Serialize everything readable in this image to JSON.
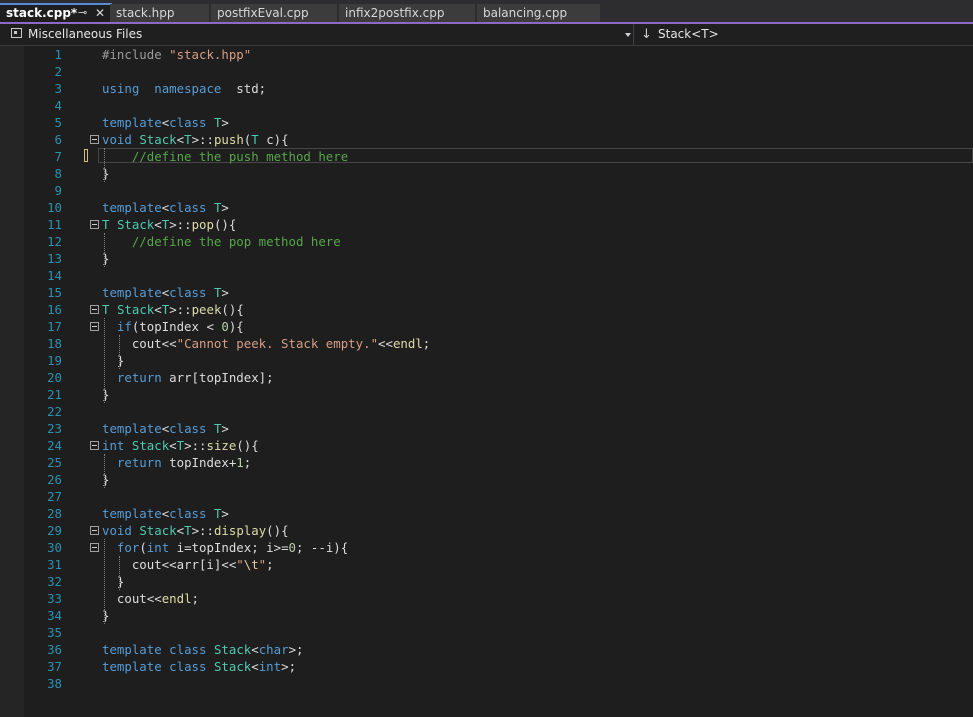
{
  "tabs": [
    {
      "label": "stack.cpp*",
      "active": true
    },
    {
      "label": "stack.hpp",
      "active": false
    },
    {
      "label": "postfixEval.cpp",
      "active": false
    },
    {
      "label": "infix2postfix.cpp",
      "active": false
    },
    {
      "label": "balancing.cpp",
      "active": false
    }
  ],
  "tab_icons": {
    "pin": "⊸",
    "close": "✕"
  },
  "navbar": {
    "project": "Miscellaneous Files",
    "scope": "Stack<T>"
  },
  "colors": {
    "keyword": "#569cd6",
    "type": "#4ec9b0",
    "function": "#dcdcaa",
    "string": "#d69d85",
    "comment": "#57a64a",
    "number": "#b5cea8",
    "line_number": "#2b91af",
    "accent": "#8f68c9"
  },
  "editor": {
    "current_line": 7,
    "lines": [
      {
        "n": "1",
        "code": [
          [
            "pp",
            "#include "
          ],
          [
            "str",
            "\"stack.hpp\""
          ]
        ]
      },
      {
        "n": "2",
        "code": []
      },
      {
        "n": "3",
        "code": [
          [
            "kw",
            "using"
          ],
          [
            "",
            "  "
          ],
          [
            "kw",
            "namespace"
          ],
          [
            "",
            "  std;"
          ]
        ]
      },
      {
        "n": "4",
        "code": []
      },
      {
        "n": "5",
        "code": [
          [
            "kw",
            "template"
          ],
          [
            "",
            "<"
          ],
          [
            "kw",
            "class"
          ],
          [
            "",
            " "
          ],
          [
            "ty",
            "T"
          ],
          [
            "",
            ">"
          ]
        ]
      },
      {
        "n": "6",
        "code": [
          [
            "kw",
            "void"
          ],
          [
            "",
            " "
          ],
          [
            "ty",
            "Stack"
          ],
          [
            "",
            "<"
          ],
          [
            "ty",
            "T"
          ],
          [
            "",
            ">::"
          ],
          [
            "fn",
            "push"
          ],
          [
            "",
            "("
          ],
          [
            "ty",
            "T"
          ],
          [
            "",
            " c){"
          ]
        ]
      },
      {
        "n": "7",
        "code": [
          [
            "",
            "    "
          ],
          [
            "cm",
            "//define the push method here"
          ]
        ]
      },
      {
        "n": "8",
        "code": [
          [
            "",
            "}"
          ]
        ]
      },
      {
        "n": "9",
        "code": []
      },
      {
        "n": "10",
        "code": [
          [
            "kw",
            "template"
          ],
          [
            "",
            "<"
          ],
          [
            "kw",
            "class"
          ],
          [
            "",
            " "
          ],
          [
            "ty",
            "T"
          ],
          [
            "",
            ">"
          ]
        ]
      },
      {
        "n": "11",
        "code": [
          [
            "ty",
            "T"
          ],
          [
            "",
            " "
          ],
          [
            "ty",
            "Stack"
          ],
          [
            "",
            "<"
          ],
          [
            "ty",
            "T"
          ],
          [
            "",
            ">::"
          ],
          [
            "fn",
            "pop"
          ],
          [
            "",
            "(){"
          ]
        ]
      },
      {
        "n": "12",
        "code": [
          [
            "",
            "    "
          ],
          [
            "cm",
            "//define the pop method here"
          ]
        ]
      },
      {
        "n": "13",
        "code": [
          [
            "",
            "}"
          ]
        ]
      },
      {
        "n": "14",
        "code": []
      },
      {
        "n": "15",
        "code": [
          [
            "kw",
            "template"
          ],
          [
            "",
            "<"
          ],
          [
            "kw",
            "class"
          ],
          [
            "",
            " "
          ],
          [
            "ty",
            "T"
          ],
          [
            "",
            ">"
          ]
        ]
      },
      {
        "n": "16",
        "code": [
          [
            "ty",
            "T"
          ],
          [
            "",
            " "
          ],
          [
            "ty",
            "Stack"
          ],
          [
            "",
            "<"
          ],
          [
            "ty",
            "T"
          ],
          [
            "",
            ">::"
          ],
          [
            "fn",
            "peek"
          ],
          [
            "",
            "(){"
          ]
        ]
      },
      {
        "n": "17",
        "code": [
          [
            "",
            "  "
          ],
          [
            "kw",
            "if"
          ],
          [
            "",
            "(topIndex < "
          ],
          [
            "num",
            "0"
          ],
          [
            "",
            "){"
          ]
        ]
      },
      {
        "n": "18",
        "code": [
          [
            "",
            "    cout<<"
          ],
          [
            "str",
            "\"Cannot peek. Stack empty.\""
          ],
          [
            "",
            "<<"
          ],
          [
            "fn",
            "endl"
          ],
          [
            "",
            ";"
          ]
        ]
      },
      {
        "n": "19",
        "code": [
          [
            "",
            "  }"
          ]
        ]
      },
      {
        "n": "20",
        "code": [
          [
            "",
            "  "
          ],
          [
            "kw",
            "return"
          ],
          [
            "",
            " arr[topIndex];"
          ]
        ]
      },
      {
        "n": "21",
        "code": [
          [
            "",
            "}"
          ]
        ]
      },
      {
        "n": "22",
        "code": []
      },
      {
        "n": "23",
        "code": [
          [
            "kw",
            "template"
          ],
          [
            "",
            "<"
          ],
          [
            "kw",
            "class"
          ],
          [
            "",
            " "
          ],
          [
            "ty",
            "T"
          ],
          [
            "",
            ">"
          ]
        ]
      },
      {
        "n": "24",
        "code": [
          [
            "kw",
            "int"
          ],
          [
            "",
            " "
          ],
          [
            "ty",
            "Stack"
          ],
          [
            "",
            "<"
          ],
          [
            "ty",
            "T"
          ],
          [
            "",
            ">::"
          ],
          [
            "fn",
            "size"
          ],
          [
            "",
            "(){"
          ]
        ]
      },
      {
        "n": "25",
        "code": [
          [
            "",
            "  "
          ],
          [
            "kw",
            "return"
          ],
          [
            "",
            " topIndex+"
          ],
          [
            "num",
            "1"
          ],
          [
            "",
            ";"
          ]
        ]
      },
      {
        "n": "26",
        "code": [
          [
            "",
            "}"
          ]
        ]
      },
      {
        "n": "27",
        "code": []
      },
      {
        "n": "28",
        "code": [
          [
            "kw",
            "template"
          ],
          [
            "",
            "<"
          ],
          [
            "kw",
            "class"
          ],
          [
            "",
            " "
          ],
          [
            "ty",
            "T"
          ],
          [
            "",
            ">"
          ]
        ]
      },
      {
        "n": "29",
        "code": [
          [
            "kw",
            "void"
          ],
          [
            "",
            " "
          ],
          [
            "ty",
            "Stack"
          ],
          [
            "",
            "<"
          ],
          [
            "ty",
            "T"
          ],
          [
            "",
            ">::"
          ],
          [
            "fn",
            "display"
          ],
          [
            "",
            "(){"
          ]
        ]
      },
      {
        "n": "30",
        "code": [
          [
            "",
            "  "
          ],
          [
            "kw",
            "for"
          ],
          [
            "",
            "("
          ],
          [
            "kw",
            "int"
          ],
          [
            "",
            " i=topIndex; i>="
          ],
          [
            "num",
            "0"
          ],
          [
            "",
            "; --i){"
          ]
        ]
      },
      {
        "n": "31",
        "code": [
          [
            "",
            "    cout<<arr[i]<<"
          ],
          [
            "str",
            "\""
          ],
          [
            "esc",
            "\\t"
          ],
          [
            "str",
            "\""
          ],
          [
            "",
            ";"
          ]
        ]
      },
      {
        "n": "32",
        "code": [
          [
            "",
            "  }"
          ]
        ]
      },
      {
        "n": "33",
        "code": [
          [
            "",
            "  cout<<"
          ],
          [
            "fn",
            "endl"
          ],
          [
            "",
            ";"
          ]
        ]
      },
      {
        "n": "34",
        "code": [
          [
            "",
            "}"
          ]
        ]
      },
      {
        "n": "35",
        "code": []
      },
      {
        "n": "36",
        "code": [
          [
            "kw",
            "template"
          ],
          [
            "",
            " "
          ],
          [
            "kw",
            "class"
          ],
          [
            "",
            " "
          ],
          [
            "ty",
            "Stack"
          ],
          [
            "",
            "<"
          ],
          [
            "kw",
            "char"
          ],
          [
            "",
            ">;"
          ]
        ]
      },
      {
        "n": "37",
        "code": [
          [
            "kw",
            "template"
          ],
          [
            "",
            " "
          ],
          [
            "kw",
            "class"
          ],
          [
            "",
            " "
          ],
          [
            "ty",
            "Stack"
          ],
          [
            "",
            "<"
          ],
          [
            "kw",
            "int"
          ],
          [
            "",
            ">;"
          ]
        ]
      },
      {
        "n": "38",
        "code": []
      }
    ]
  }
}
